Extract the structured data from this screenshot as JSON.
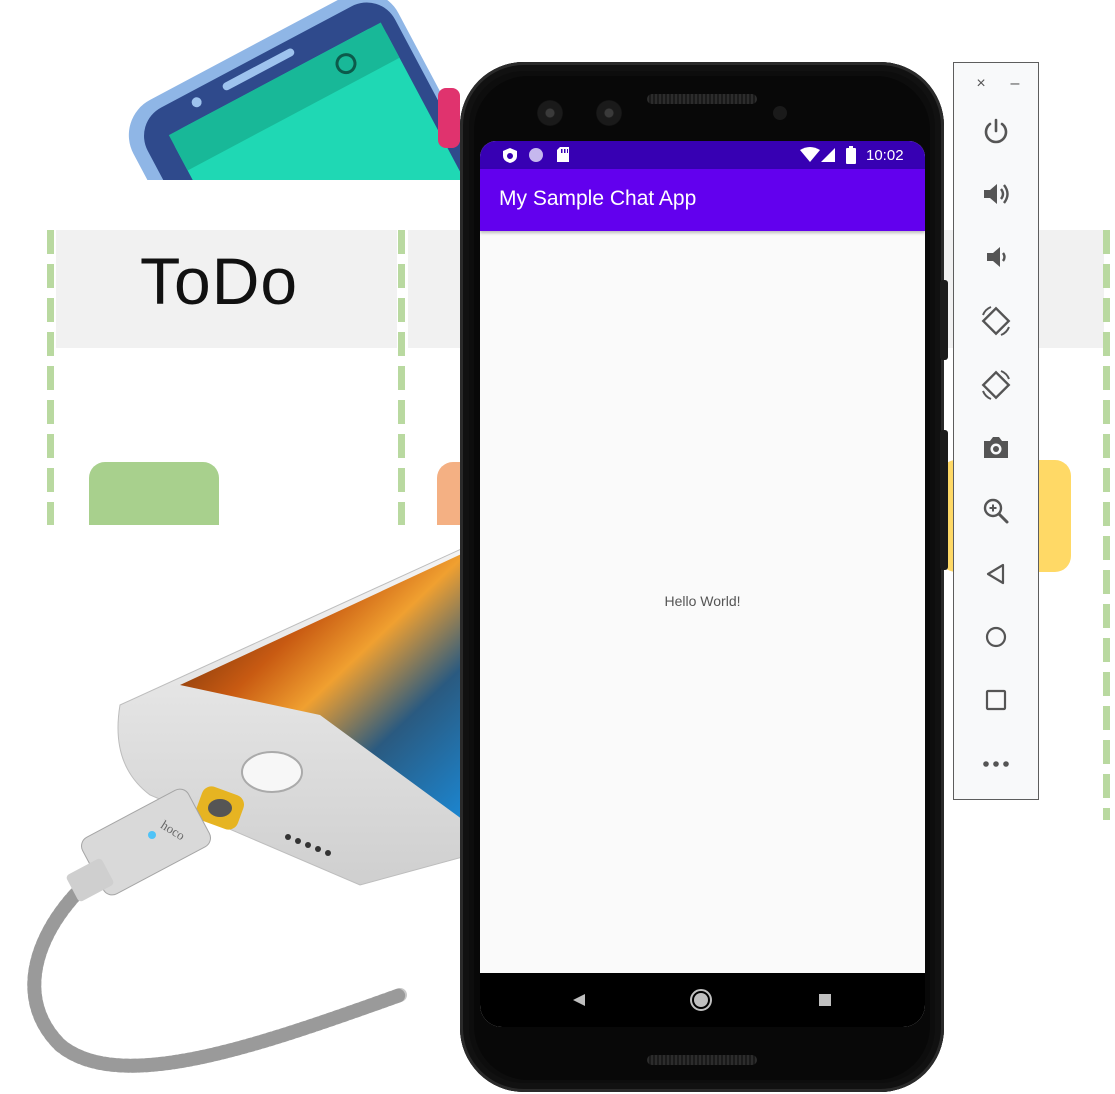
{
  "background": {
    "board": {
      "column_title": "ToDo"
    },
    "iphone": {
      "cable_brand": "hoco"
    }
  },
  "emulator": {
    "status_bar": {
      "time": "10:02"
    },
    "app_bar": {
      "title": "My Sample Chat App"
    },
    "content": {
      "text": "Hello World!"
    },
    "colors": {
      "status_bar": "#3700b3",
      "app_bar": "#6200ee"
    }
  },
  "toolbar": {
    "buttons": [
      "power-icon",
      "volume-up-icon",
      "volume-down-icon",
      "rotate-left-icon",
      "rotate-right-icon",
      "camera-icon",
      "zoom-icon",
      "back-icon",
      "home-icon",
      "overview-icon",
      "more-icon"
    ]
  }
}
